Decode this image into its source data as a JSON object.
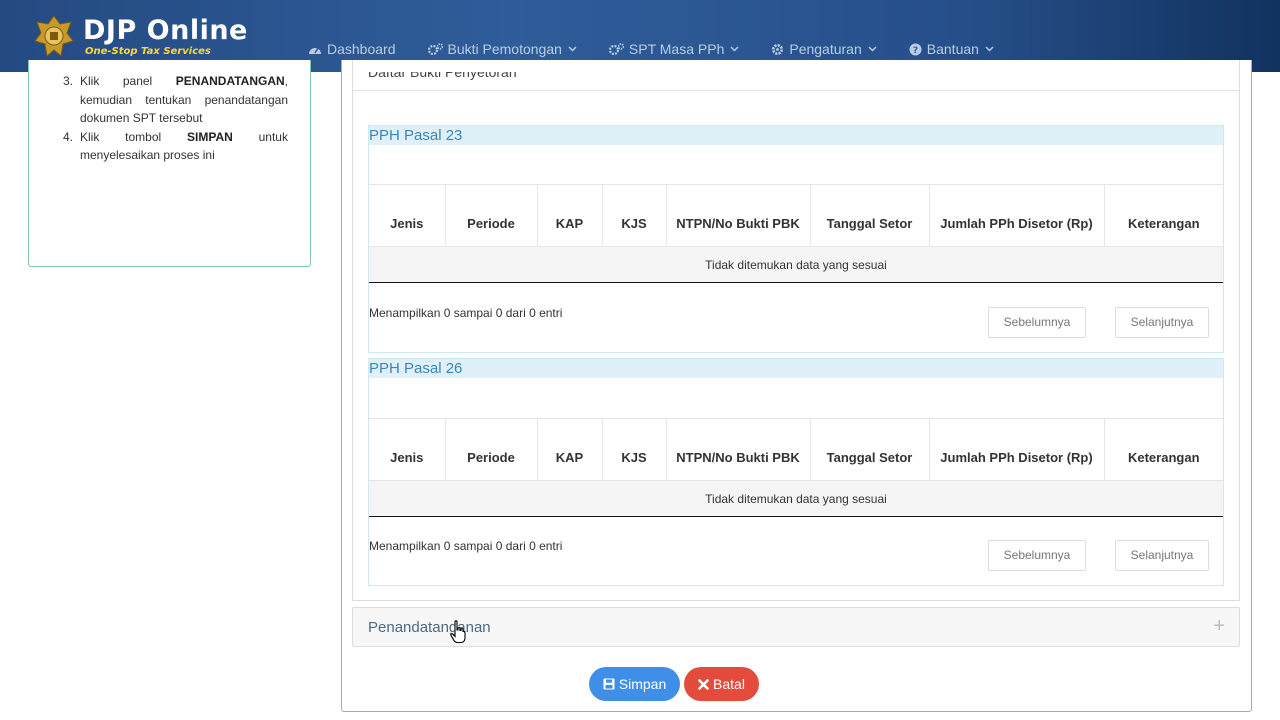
{
  "header": {
    "brand_title": "DJP Online",
    "brand_subtitle": "One-Stop Tax Services",
    "nav": [
      {
        "label": "Dashboard",
        "icon": "dashboard-icon",
        "dropdown": false
      },
      {
        "label": "Bukti Pemotongan",
        "icon": "cogs-icon",
        "dropdown": true
      },
      {
        "label": "SPT Masa PPh",
        "icon": "cogs-icon",
        "dropdown": true
      },
      {
        "label": "Pengaturan",
        "icon": "gear-icon",
        "dropdown": true
      },
      {
        "label": "Bantuan",
        "icon": "question-circle-icon",
        "dropdown": true
      }
    ]
  },
  "sidebar": {
    "steps": [
      {
        "num": "3.",
        "pre": "Klik panel ",
        "bold": "PENANDATANGAN",
        "post": ", kemudian tentukan penandatangan dokumen SPT tersebut"
      },
      {
        "num": "4.",
        "pre": "Klik tombol ",
        "bold": "SIMPAN",
        "post": " untuk menyelesaikan proses ini"
      }
    ]
  },
  "main": {
    "list_title": "Daftar Bukti Penyetoran",
    "columns": [
      "Jenis",
      "Periode",
      "KAP",
      "KJS",
      "NTPN/No Bukti PBK",
      "Tanggal Setor",
      "Jumlah PPh Disetor (Rp)",
      "Keterangan"
    ],
    "sections": [
      {
        "title": "PPH Pasal 23",
        "empty_text": "Tidak ditemukan data yang sesuai",
        "info": "Menampilkan 0 sampai 0 dari 0 entri",
        "prev": "Sebelumnya",
        "next": "Selanjutnya"
      },
      {
        "title": "PPH Pasal 26",
        "empty_text": "Tidak ditemukan data yang sesuai",
        "info": "Menampilkan 0 sampai 0 dari 0 entri",
        "prev": "Sebelumnya",
        "next": "Selanjutnya"
      }
    ],
    "signer_panel": "Penandatanganan",
    "signer_toggle": "+"
  },
  "actions": {
    "save": "Simpan",
    "cancel": "Batal"
  },
  "colors": {
    "header": "#2f5d99",
    "brand_subtitle": "#ffd83a",
    "section_title": "#3a86b8",
    "save": "#3f8ee8",
    "cancel": "#e34b3c"
  }
}
